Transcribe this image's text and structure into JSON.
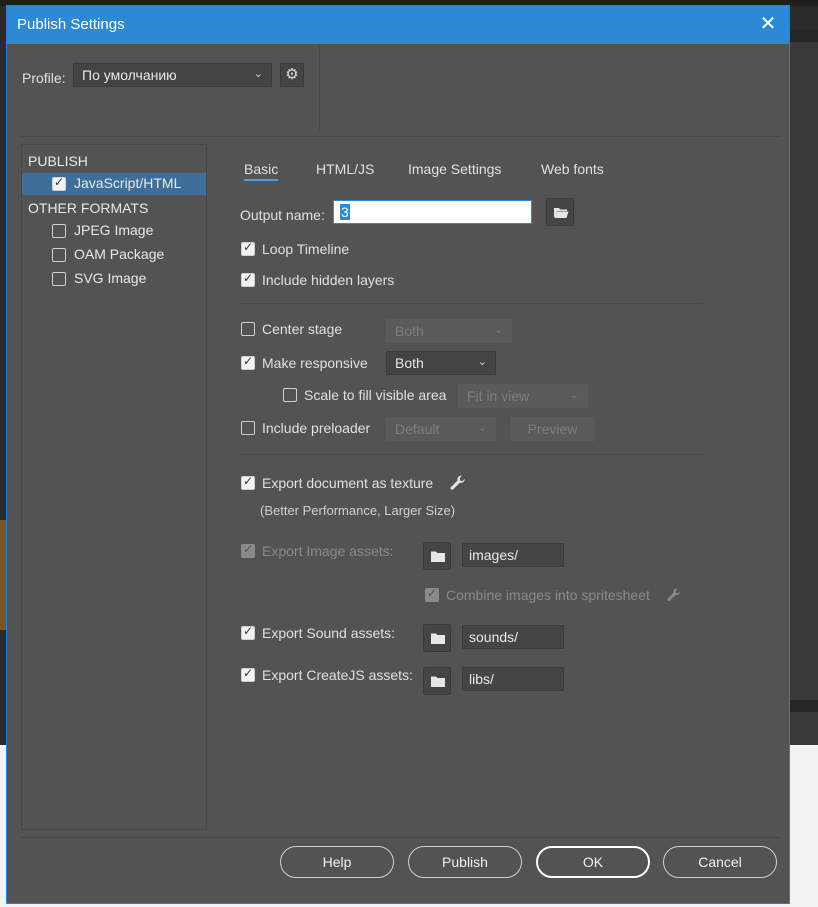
{
  "window": {
    "title": "Publish Settings",
    "close_glyph": "✕"
  },
  "profile": {
    "label": "Profile:",
    "value": "По умолчанию"
  },
  "sidebar": {
    "publish_header": "PUBLISH",
    "publish_items": [
      {
        "label": "JavaScript/HTML",
        "checked": true,
        "selected": true
      }
    ],
    "other_header": "OTHER FORMATS",
    "other_items": [
      {
        "label": "JPEG Image",
        "checked": false
      },
      {
        "label": "OAM Package",
        "checked": false
      },
      {
        "label": "SVG Image",
        "checked": false
      }
    ]
  },
  "tabs": [
    "Basic",
    "HTML/JS",
    "Image Settings",
    "Web fonts"
  ],
  "basic": {
    "output_name_label": "Output name:",
    "output_name_value": "3",
    "loop_timeline": "Loop Timeline",
    "include_hidden_layers": "Include hidden layers",
    "center_stage": "Center stage",
    "center_stage_value": "Both",
    "make_responsive": "Make responsive",
    "make_responsive_value": "Both",
    "scale_to_fill": "Scale to fill visible area",
    "scale_to_fill_value": "Fit in view",
    "include_preloader": "Include preloader",
    "preloader_value": "Default",
    "preview_button": "Preview",
    "export_texture": "Export document as texture",
    "export_texture_note": "(Better Performance, Larger Size)",
    "export_image_assets": "Export Image assets:",
    "image_assets_path": "images/",
    "combine_images": "Combine images into spritesheet",
    "export_sound_assets": "Export Sound assets:",
    "sound_assets_path": "sounds/",
    "export_createjs_assets": "Export CreateJS assets:",
    "createjs_assets_path": "libs/"
  },
  "footer": {
    "help": "Help",
    "publish": "Publish",
    "ok": "OK",
    "cancel": "Cancel"
  },
  "colors": {
    "titlebar": "#2b8ad2",
    "dialog_bg": "#535353",
    "selection": "#3d6f9a",
    "tab_underline": "#4a9ee6"
  },
  "icons": [
    "close-icon",
    "gear-icon",
    "folder-icon",
    "wrench-icon",
    "chevron-down-icon",
    "checkbox-icon"
  ]
}
